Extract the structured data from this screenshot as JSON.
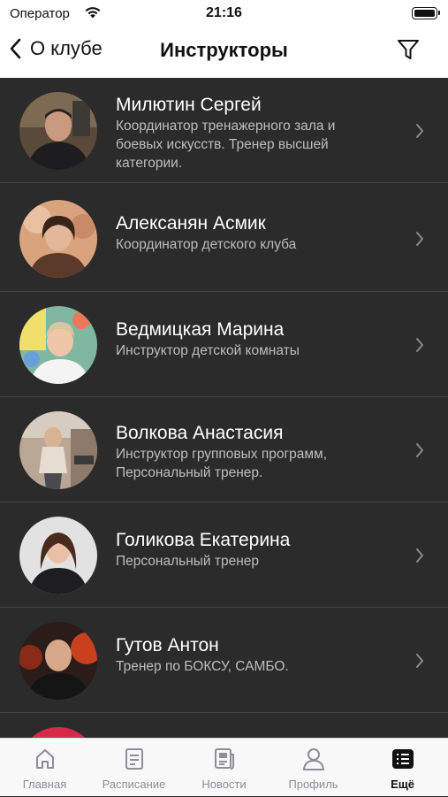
{
  "status_bar": {
    "carrier": "Оператор",
    "time": "21:16"
  },
  "navbar": {
    "back_label": "О клубе",
    "title": "Инструкторы"
  },
  "instructors": [
    {
      "name": "Милютин Сергей",
      "role": "Координатор тренажерного зала и\nбоевых искусств. Тренер высшей\nкатегории."
    },
    {
      "name": "Алексанян Асмик",
      "role": "Координатор детского клуба"
    },
    {
      "name": "Ведмицкая Марина",
      "role": "Инструктор детской комнаты"
    },
    {
      "name": "Волкова Анастасия",
      "role": "Инструктор групповых программ,\nПерсональный тренер."
    },
    {
      "name": "Голикова Екатерина",
      "role": "Персональный тренер"
    },
    {
      "name": "Гутов Антон",
      "role": "Тренер по БОКСУ, САМБО."
    }
  ],
  "tabs": [
    {
      "label": "Главная",
      "icon": "home-icon"
    },
    {
      "label": "Расписание",
      "icon": "schedule-icon"
    },
    {
      "label": "Новости",
      "icon": "news-icon"
    },
    {
      "label": "Профиль",
      "icon": "profile-icon"
    },
    {
      "label": "Ещё",
      "icon": "more-icon",
      "active": true
    }
  ],
  "colors": {
    "list_background": "#2b2b2b",
    "separator": "#444444",
    "text_primary": "#ffffff",
    "text_secondary": "#bdbdbd",
    "tab_inactive": "#8e8e93"
  }
}
